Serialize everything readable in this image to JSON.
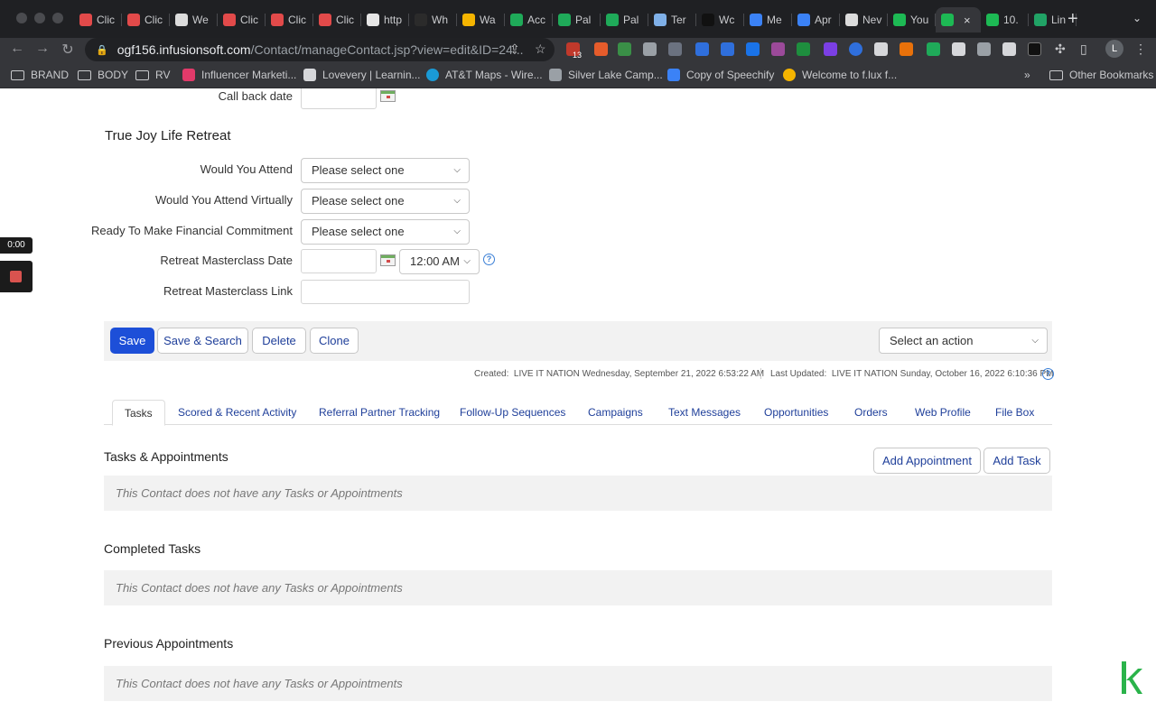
{
  "browser": {
    "tabs": [
      {
        "label": "Clic",
        "color": "#e24a4a"
      },
      {
        "label": "Clic",
        "color": "#e24a4a"
      },
      {
        "label": "We",
        "color": "#dcdcdc"
      },
      {
        "label": "Clic",
        "color": "#e24a4a"
      },
      {
        "label": "Clic",
        "color": "#e24a4a"
      },
      {
        "label": "Clic",
        "color": "#e24a4a"
      },
      {
        "label": "http",
        "color": "#e6e6e6"
      },
      {
        "label": "Wh",
        "color": "#2b2b2b"
      },
      {
        "label": "Wa",
        "color": "#f4b400"
      },
      {
        "label": "Acc",
        "color": "#1faa59"
      },
      {
        "label": "Pal",
        "color": "#1faa59"
      },
      {
        "label": "Pal",
        "color": "#1faa59"
      },
      {
        "label": "Ter",
        "color": "#7fb0e8"
      },
      {
        "label": "Wc",
        "color": "#111111"
      },
      {
        "label": "Me",
        "color": "#3b82f6"
      },
      {
        "label": "Apr",
        "color": "#3b82f6"
      },
      {
        "label": "Nev",
        "color": "#dcdcdc"
      },
      {
        "label": "You",
        "color": "#1db954"
      }
    ],
    "active_tab": {
      "label": "",
      "color": "#1db954",
      "close": "×"
    },
    "tabs_after": [
      {
        "label": "10.",
        "color": "#1db954"
      },
      {
        "label": "Lin",
        "color": "#21a366"
      }
    ],
    "new_tab": "+",
    "url_host": "ogf156.infusionsoft.com",
    "url_path": "/Contact/manageContact.jsp?view=edit&ID=24...",
    "extension_badge": "13",
    "profile_initial": "L",
    "bookmarks": [
      {
        "label": "BRAND",
        "icon": "folder-icon"
      },
      {
        "label": "BODY",
        "icon": "folder-icon"
      },
      {
        "label": "RV",
        "icon": "folder-icon"
      },
      {
        "label": "Influencer Marketi...",
        "icon": "diamond-icon"
      },
      {
        "label": "Lovevery | Learnin...",
        "icon": "lovevery-icon"
      },
      {
        "label": "AT&T Maps - Wire...",
        "icon": "att-icon"
      },
      {
        "label": "Silver Lake Camp...",
        "icon": "compass-icon"
      },
      {
        "label": "Copy of Speechify",
        "icon": "speechify-icon"
      },
      {
        "label": "Welcome to f.lux f...",
        "icon": "flux-icon"
      }
    ],
    "more_bookmarks": "»",
    "other_bookmarks": "Other Bookmarks"
  },
  "form": {
    "callback_label": "Call back date",
    "section_title": "True Joy Life Retreat",
    "attend_label": "Would You Attend",
    "attend_value": "Please select one",
    "virtual_label": "Would You Attend Virtually",
    "virtual_value": "Please select one",
    "financial_label": "Ready To Make Financial Commitment",
    "financial_value": "Please select one",
    "masterclass_date_label": "Retreat Masterclass Date",
    "masterclass_time": "12:00 AM",
    "masterclass_link_label": "Retreat Masterclass Link"
  },
  "actions": {
    "save": "Save",
    "save_search": "Save & Search",
    "delete": "Delete",
    "clone": "Clone",
    "select_action": "Select an action"
  },
  "meta": {
    "created_label": "Created:",
    "created_value": "LIVE IT NATION Wednesday, September 21, 2022 6:53:22 AM",
    "updated_label": "Last Updated:",
    "updated_value": "LIVE IT NATION Sunday, October 16, 2022 6:10:36 PM"
  },
  "tabs": [
    "Tasks",
    "Scored & Recent Activity",
    "Referral Partner Tracking",
    "Follow-Up Sequences",
    "Campaigns",
    "Text Messages",
    "Opportunities",
    "Orders",
    "Web Profile",
    "File Box"
  ],
  "tasks": {
    "title": "Tasks & Appointments",
    "add_appointment": "Add Appointment",
    "add_task": "Add Task",
    "empty": "This Contact does not have any Tasks or Appointments",
    "completed_title": "Completed Tasks",
    "completed_empty": "This Contact does not have any Tasks or Appointments",
    "previous_title": "Previous Appointments",
    "previous_empty": "This Contact does not have any Tasks or Appointments"
  },
  "recorder": {
    "time": "0:00"
  }
}
